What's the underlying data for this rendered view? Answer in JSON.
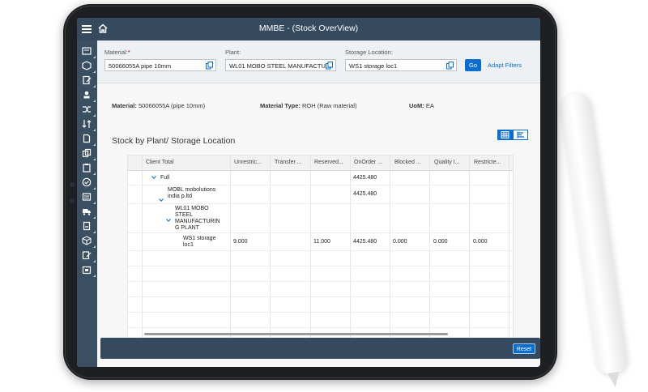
{
  "window": {
    "title": "MMBE - (Stock OverView)"
  },
  "filters": {
    "material": {
      "label": "Material:",
      "required_mark": "*",
      "value": "50066055A pipe 10mm"
    },
    "plant": {
      "label": "Plant:",
      "value": "WL01 MOBO STEEL MANUFACTU..."
    },
    "storage": {
      "label": "Storage Location:",
      "value": "WS1 storage loc1"
    },
    "go_label": "Go",
    "adapt_label": "Adapt Filters"
  },
  "info": {
    "material_label": "Material:",
    "material_value": "50066055A (pipe 10mm)",
    "type_label": "Material Type:",
    "type_value": "ROH (Raw material)",
    "uom_label": "UoM:",
    "uom_value": "EA"
  },
  "section_title": "Stock by Plant/ Storage Location",
  "table": {
    "columns": [
      "Client Total",
      "Unrestric...",
      "Transfer ...",
      "Reserved...",
      "OnOrder ...",
      "Blocked ...",
      "Quality I...",
      "Restricte..."
    ],
    "rows": [
      {
        "label": "Full",
        "onorder": "4425.480"
      },
      {
        "label_line1": "MOBL mobolutions",
        "label_line2": "india p.ltd",
        "onorder": "4425.480"
      },
      {
        "label_line1": "WL01 MOBO",
        "label_line2": "STEEL",
        "label_line3": "MANUFACTURIN",
        "label_line4": "G PLANT"
      },
      {
        "label_line1": "WS1 storage",
        "label_line2": "loc1",
        "unrestricted": "9.000",
        "reserved": "11.000",
        "onorder": "4425.480",
        "blocked": "0.000",
        "quality": "0.000",
        "restricted": "0.000"
      }
    ]
  },
  "footer": {
    "reset_label": "Reset"
  },
  "colors": {
    "shell": "#354a5f",
    "accent": "#0a6ed1",
    "required": "#bb0000"
  }
}
